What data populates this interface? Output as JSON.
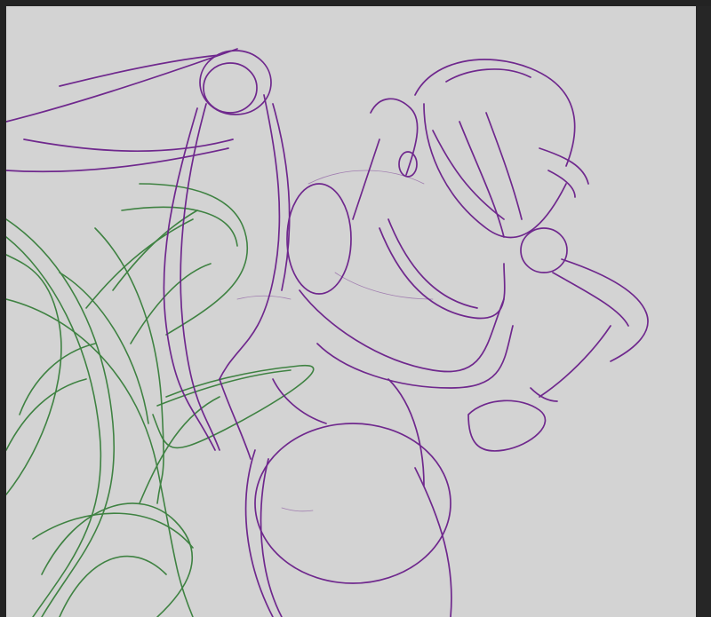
{
  "colors": {
    "canvas_background": "#d3d3d3",
    "frame_background": "#2b2b2b",
    "purple_stroke": "#6a1f8a",
    "green_stroke": "#2f7a33"
  },
  "layers": [
    {
      "name": "character-sketch",
      "color": "purple"
    },
    {
      "name": "background-plant-sketch",
      "color": "green"
    }
  ]
}
